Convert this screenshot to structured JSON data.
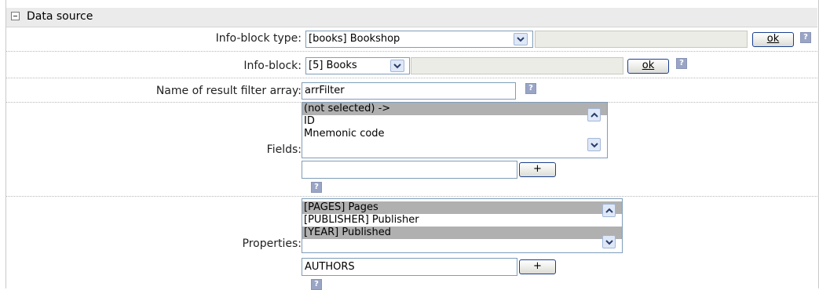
{
  "section": {
    "title": "Data source"
  },
  "infoblock_type": {
    "label": "Info-block type:",
    "value": "[books] Bookshop",
    "ok_label": "ok"
  },
  "infoblock": {
    "label": "Info-block:",
    "value": "[5] Books",
    "ok_label": "ok"
  },
  "filter_array": {
    "label": "Name of result filter array:",
    "value": "arrFilter"
  },
  "fields": {
    "label": "Fields:",
    "options": [
      "(not selected) ->",
      "ID",
      "Mnemonic code"
    ],
    "add_value": "",
    "add_label": "+"
  },
  "properties": {
    "label": "Properties:",
    "options": [
      "[PAGES] Pages",
      "[PUBLISHER] Publisher",
      "[YEAR] Published"
    ],
    "add_value": "AUTHORS",
    "add_label": "+"
  },
  "help_symbol": "?",
  "colors": {
    "header_bg": "#ebebeb",
    "selected_option": "#b0b0b0",
    "button_border": "#1a3f8f",
    "help_icon": "#9aa5c6"
  }
}
